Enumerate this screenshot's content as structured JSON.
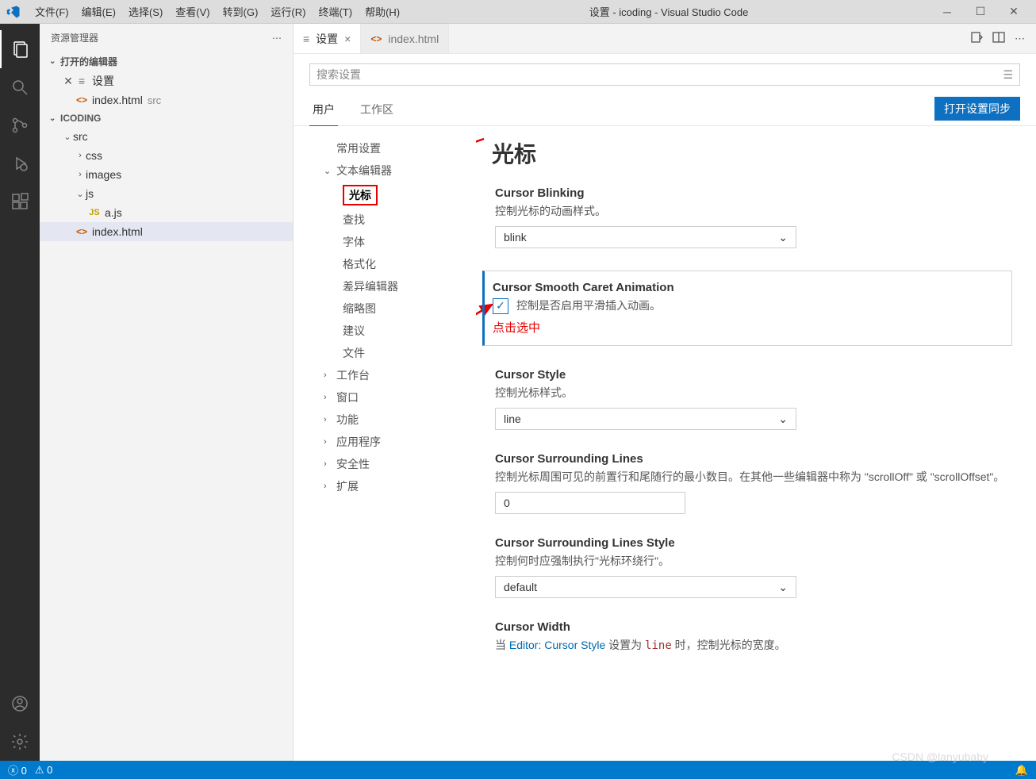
{
  "titlebar": {
    "menus": [
      "文件(F)",
      "编辑(E)",
      "选择(S)",
      "查看(V)",
      "转到(G)",
      "运行(R)",
      "终端(T)",
      "帮助(H)"
    ],
    "title": "设置 - icoding - Visual Studio Code"
  },
  "sidebar": {
    "header": "资源管理器",
    "openEditors": "打开的编辑器",
    "editors": [
      {
        "label": "设置",
        "type": "settings",
        "closable": true
      },
      {
        "label": "index.html",
        "type": "html",
        "suffix": "src"
      }
    ],
    "project": "ICODING",
    "tree": {
      "src": "src",
      "css": "css",
      "images": "images",
      "js": "js",
      "ajs": "a.js",
      "indexhtml": "index.html"
    }
  },
  "tabs": {
    "settings": "设置",
    "indexhtml": "index.html"
  },
  "settings": {
    "searchPlaceholder": "搜索设置",
    "scopeUser": "用户",
    "scopeWorkspace": "工作区",
    "syncButton": "打开设置同步",
    "toc": {
      "common": "常用设置",
      "textEditor": "文本编辑器",
      "cursor": "光标",
      "find": "查找",
      "font": "字体",
      "formatting": "格式化",
      "diffEditor": "差异编辑器",
      "minimap": "缩略图",
      "suggestions": "建议",
      "files": "文件",
      "workbench": "工作台",
      "window": "窗口",
      "features": "功能",
      "application": "应用程序",
      "security": "安全性",
      "extensions": "扩展"
    },
    "heading": "光标",
    "blinking": {
      "title": "Cursor Blinking",
      "desc": "控制光标的动画样式。",
      "value": "blink"
    },
    "smooth": {
      "title": "Cursor Smooth Caret Animation",
      "desc": "控制是否启用平滑插入动画。"
    },
    "redAnnotation": "点击选中",
    "style": {
      "title": "Cursor Style",
      "desc": "控制光标样式。",
      "value": "line"
    },
    "surrounding": {
      "title": "Cursor Surrounding Lines",
      "desc": "控制光标周围可见的前置行和尾随行的最小数目。在其他一些编辑器中称为 \"scrollOff\" 或 \"scrollOffset\"。",
      "value": "0"
    },
    "surroundingStyle": {
      "title": "Cursor Surrounding Lines Style",
      "desc": "控制何时应强制执行\"光标环绕行\"。",
      "value": "default"
    },
    "width": {
      "title": "Cursor Width",
      "descPrefix": "当 ",
      "descLink": "Editor: Cursor Style",
      "descMid": " 设置为 ",
      "descCode": "line",
      "descSuffix": " 时，控制光标的宽度。"
    }
  },
  "statusbar": {
    "errors": "0",
    "warnings": "0"
  },
  "watermark": "CSDN @lanyubaby"
}
